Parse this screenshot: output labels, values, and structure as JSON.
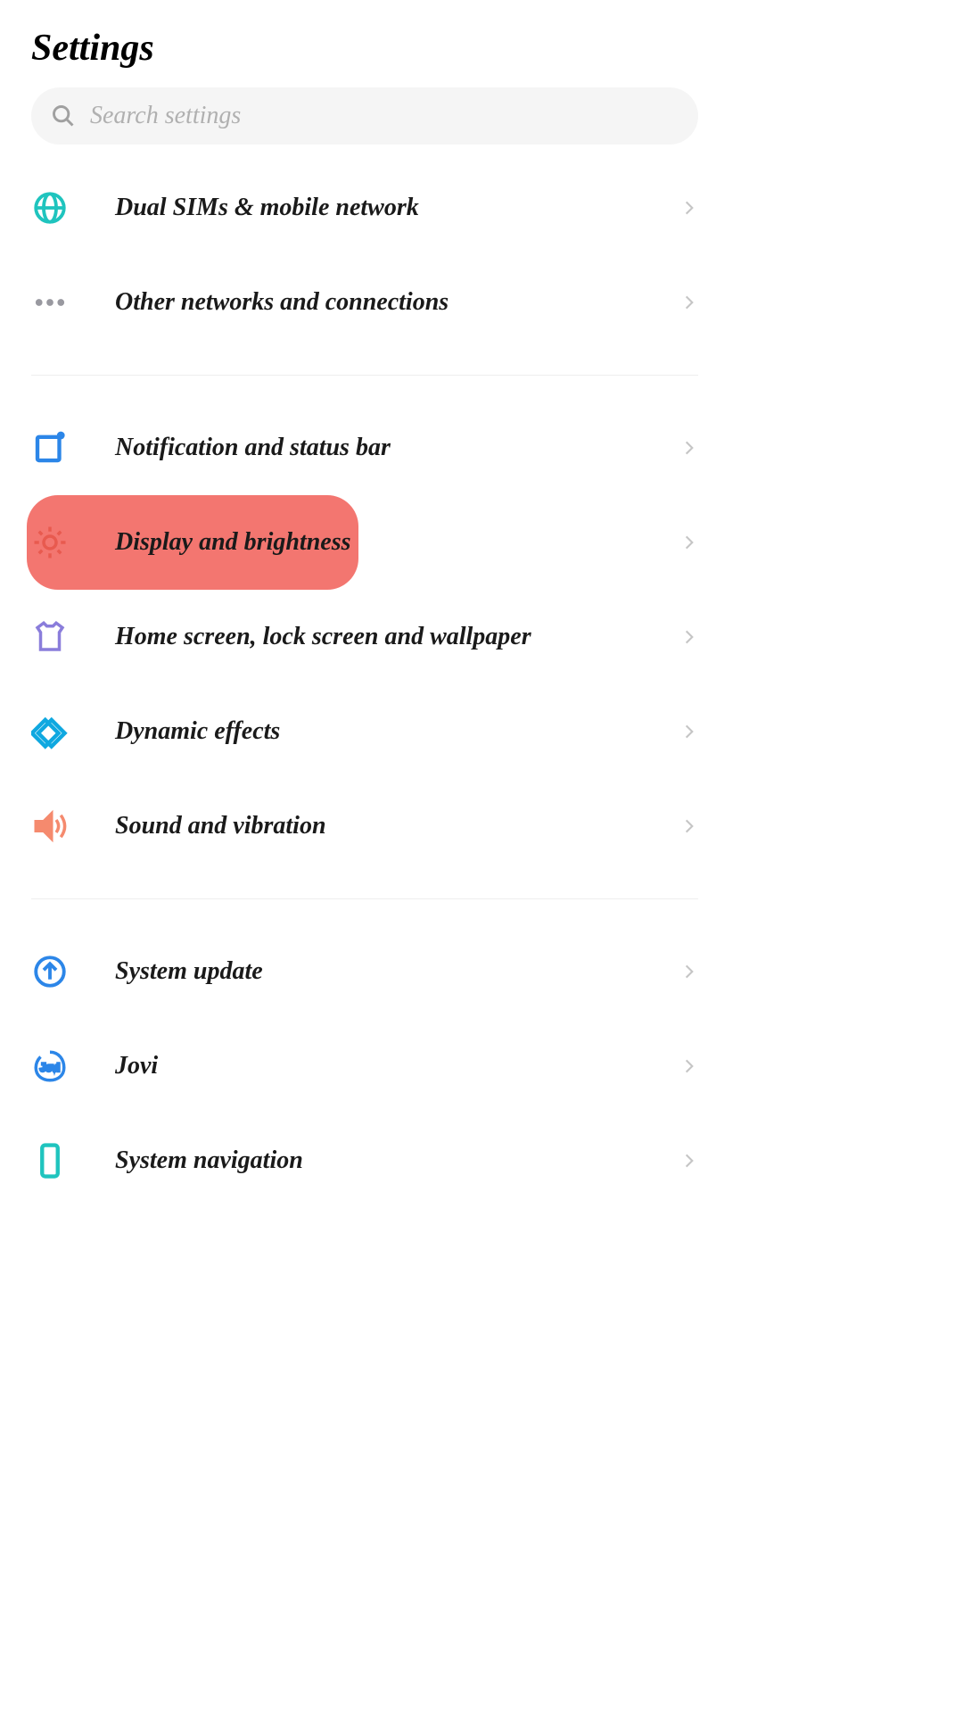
{
  "header": {
    "title": "Settings"
  },
  "search": {
    "placeholder": "Search settings"
  },
  "groups": [
    {
      "items": [
        {
          "id": "dual-sims",
          "label": "Dual SIMs & mobile network",
          "icon": "globe"
        },
        {
          "id": "other-networks",
          "label": "Other networks and connections",
          "icon": "dots"
        }
      ]
    },
    {
      "items": [
        {
          "id": "notification",
          "label": "Notification and status bar",
          "icon": "notification"
        },
        {
          "id": "display",
          "label": "Display and brightness",
          "icon": "brightness",
          "highlighted": true
        },
        {
          "id": "home-screen",
          "label": "Home screen, lock screen and wallpaper",
          "icon": "tshirt"
        },
        {
          "id": "dynamic-effects",
          "label": "Dynamic effects",
          "icon": "diamond"
        },
        {
          "id": "sound",
          "label": "Sound and vibration",
          "icon": "speaker"
        }
      ]
    },
    {
      "items": [
        {
          "id": "system-update",
          "label": "System update",
          "icon": "update"
        },
        {
          "id": "jovi",
          "label": "Jovi",
          "icon": "jovi"
        },
        {
          "id": "system-navigation",
          "label": "System navigation",
          "icon": "phone"
        }
      ]
    }
  ],
  "colors": {
    "highlight": "#f37670",
    "teal": "#1fc4be",
    "blue": "#2c86e8",
    "coral": "#f58a6e",
    "purple": "#8a7ddb",
    "gray": "#9999a0"
  }
}
